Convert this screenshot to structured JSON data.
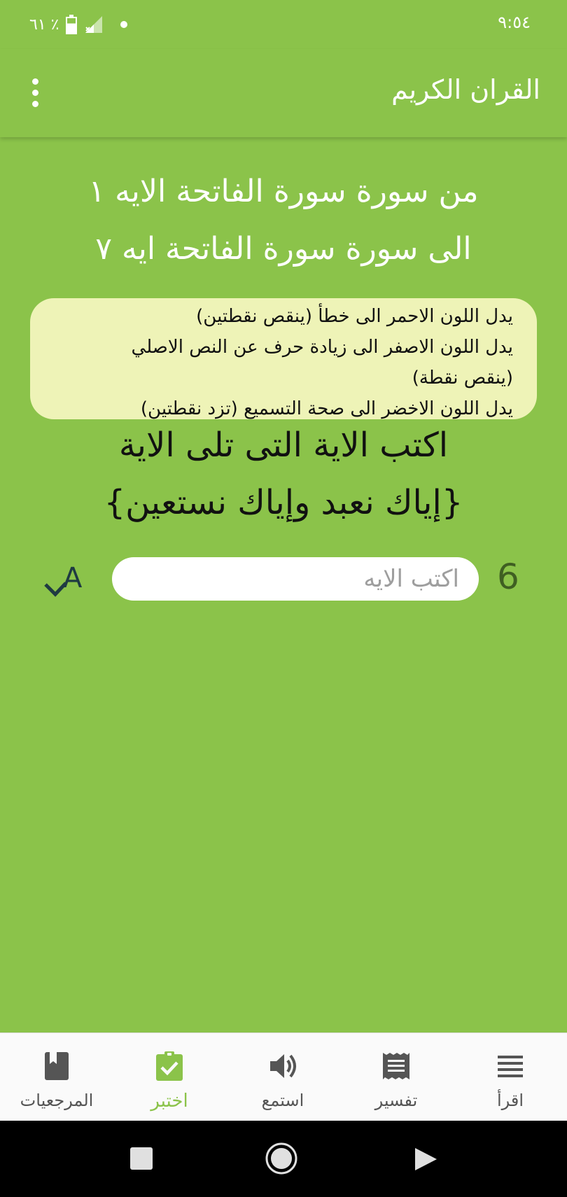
{
  "status_bar": {
    "time": "٩:٥٤",
    "battery": "٦١ ٪"
  },
  "app_bar": {
    "title": "القران الكريم",
    "more_icon": "more-vert-icon"
  },
  "range": {
    "line1": "من سورة سورة الفاتحة الايه ١",
    "line2": "الى سورة سورة الفاتحة ايه ٧"
  },
  "legend": {
    "red": "يدل اللون الاحمر الى خطأ (ينقص نقطتين)",
    "yellow_a": "يدل اللون الاصفر الى زيادة حرف عن النص الاصلي",
    "yellow_b": "(ينقص نقطة)",
    "green": "يدل اللون الاخضر الى صحة التسميع (تزد نقطتين)"
  },
  "question": {
    "instruction": "اكتب الاية التى تلى الاية",
    "verse": "{إياك نعبد وإياك نستعين}"
  },
  "answer": {
    "number": "6",
    "placeholder": "اكتب الايه",
    "value": "",
    "check_icon": "spellcheck-icon"
  },
  "bottom_nav": {
    "items": [
      {
        "label": "اقرأ",
        "icon": "list-icon",
        "active": false
      },
      {
        "label": "تفسير",
        "icon": "receipt-icon",
        "active": false
      },
      {
        "label": "استمع",
        "icon": "volume-icon",
        "active": false
      },
      {
        "label": "اختبر",
        "icon": "assignment-check-icon",
        "active": true
      },
      {
        "label": "المرجعيات",
        "icon": "book-icon",
        "active": false
      }
    ]
  },
  "colors": {
    "primary": "#8bc34a",
    "legend_bg": "#eef3b7",
    "active_nav": "#8bc34a",
    "number": "#3f5f22"
  }
}
